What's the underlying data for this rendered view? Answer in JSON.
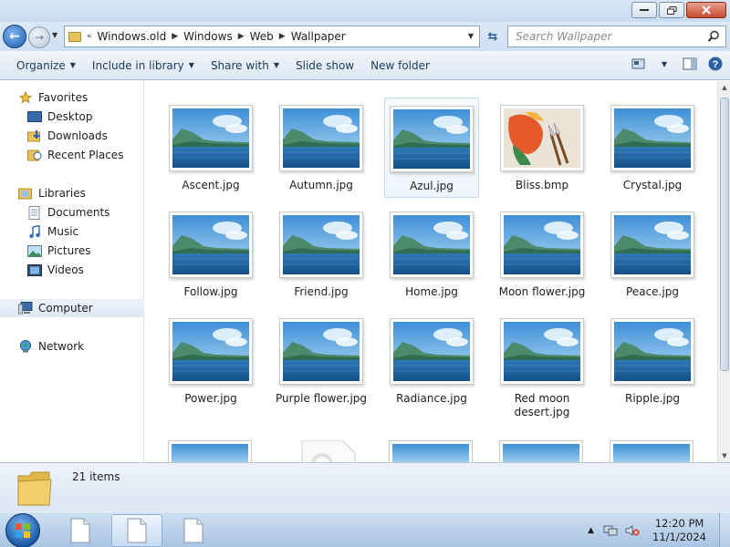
{
  "address_bar": {
    "overflow": "«",
    "crumbs": [
      "Windows.old",
      "Windows",
      "Web",
      "Wallpaper"
    ]
  },
  "search": {
    "placeholder": "Search Wallpaper"
  },
  "toolbar": {
    "organize": "Organize",
    "include_in_library": "Include in library",
    "share_with": "Share with",
    "slide_show": "Slide show",
    "new_folder": "New folder"
  },
  "nav": {
    "favorites": "Favorites",
    "desktop": "Desktop",
    "downloads": "Downloads",
    "recent_places": "Recent Places",
    "libraries": "Libraries",
    "documents": "Documents",
    "music": "Music",
    "pictures": "Pictures",
    "videos": "Videos",
    "computer": "Computer",
    "network": "Network"
  },
  "files": [
    "Ascent.jpg",
    "Autumn.jpg",
    "Azul.jpg",
    "Bliss.bmp",
    "Crystal.jpg",
    "Follow.jpg",
    "Friend.jpg",
    "Home.jpg",
    "Moon flower.jpg",
    "Peace.jpg",
    "Power.jpg",
    "Purple flower.jpg",
    "Radiance.jpg",
    "Red moon desert.jpg",
    "Ripple.jpg"
  ],
  "details": {
    "items_count": "21 items"
  },
  "clock": {
    "time": "12:20 PM",
    "date": "11/1/2024"
  },
  "colors": {
    "accent": "#1c5bb4",
    "selection": "#dde8f5"
  }
}
